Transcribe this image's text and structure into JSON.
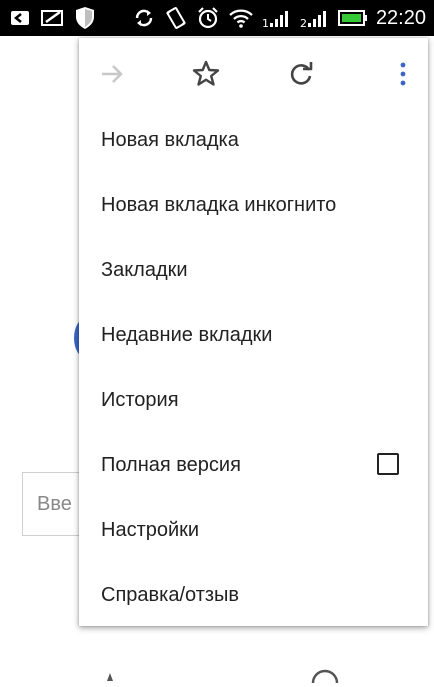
{
  "status_bar": {
    "time": "22:20",
    "left_icons": [
      "back-arrow-icon",
      "notification-icon",
      "shield-icon"
    ],
    "right_icons": [
      "sync-icon",
      "rotate-icon",
      "alarm-icon",
      "wifi-icon",
      "signal-1-icon",
      "signal-2-icon",
      "battery-icon"
    ]
  },
  "background": {
    "input_placeholder": "Вве"
  },
  "menu": {
    "toolbar": {
      "forward_icon": "forward-arrow-icon",
      "bookmark_icon": "star-icon",
      "reload_icon": "reload-icon",
      "more_icon": "more-vertical-icon"
    },
    "items": [
      {
        "label": "Новая вкладка"
      },
      {
        "label": "Новая вкладка инкогнито"
      },
      {
        "label": "Закладки"
      },
      {
        "label": "Недавние вкладки"
      },
      {
        "label": "История"
      },
      {
        "label": "Полная версия",
        "checked": false
      },
      {
        "label": "Настройки"
      },
      {
        "label": "Справка/отзыв"
      }
    ]
  },
  "colors": {
    "status_bar_bg": "#000000",
    "menu_text": "#222222",
    "icon_gray": "#555555",
    "icon_disabled": "#c8c8c8",
    "accent_blue": "#3b66c4"
  }
}
